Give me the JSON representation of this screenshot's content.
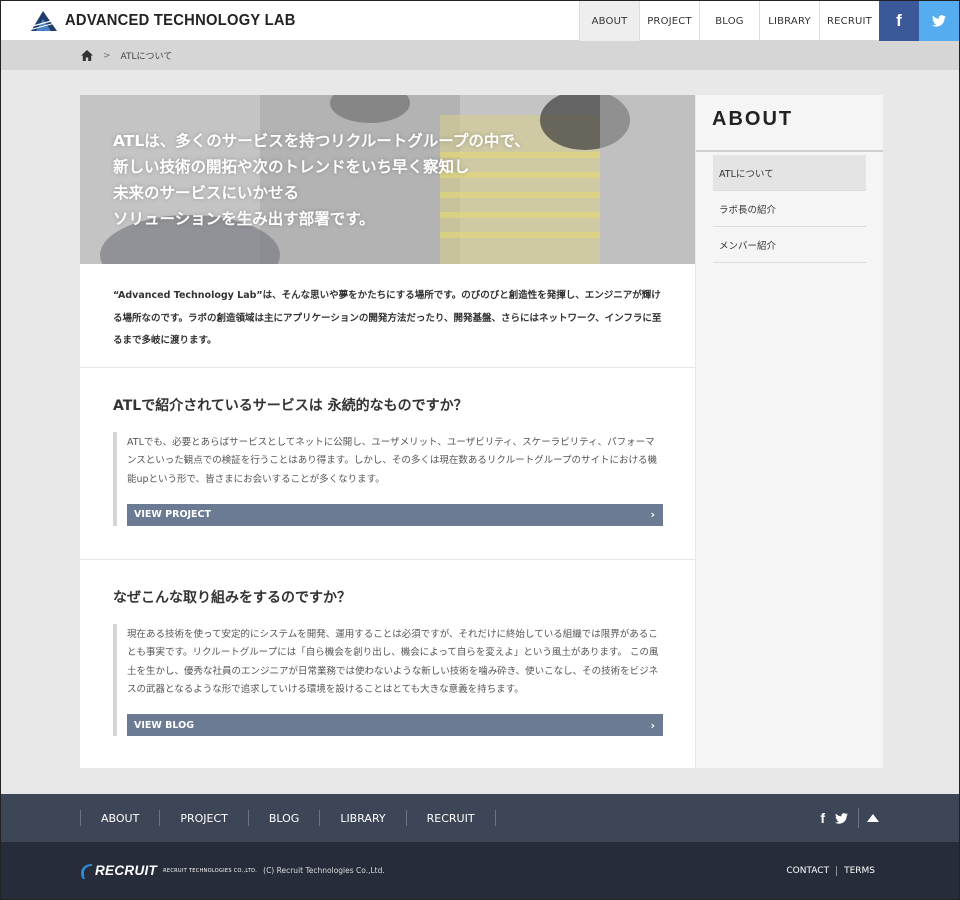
{
  "header": {
    "site_name": "ADVANCED TECHNOLOGY LAB",
    "nav": [
      "ABOUT",
      "PROJECT",
      "BLOG",
      "LIBRARY",
      "RECRUIT"
    ],
    "active_nav": "ABOUT",
    "facebook": "f",
    "colors": {
      "facebook": "#3b5998",
      "twitter": "#55acee"
    }
  },
  "breadcrumb": {
    "sep": ">",
    "current": "ATLについて"
  },
  "hero": {
    "lines": [
      "ATLは、多くのサービスを持つリクルートグループの中で、",
      "新しい技術の開拓や次のトレンドをいち早く察知し",
      "未来のサービスにいかせる",
      "ソリューションを生み出す部署です。"
    ]
  },
  "intro": "“Advanced Technology Lab”は、そんな思いや夢をかたちにする場所です。のびのびと創造性を発揮し、エンジニアが輝ける場所なのです。ラボの創造領域は主にアプリケーションの開発方法だったり、開発基盤、さらにはネットワーク、インフラに至るまで多岐に渡ります。",
  "sections": [
    {
      "title": "ATLで紹介されているサービスは 永続的なものですか？",
      "text": "ATLでも、必要とあらばサービスとしてネットに公開し、ユーザメリット、ユーザビリティ、スケーラビリティ、パフォーマンスといった観点での検証を行うことはあり得ます。しかし、その多くは現在数あるリクルートグループのサイトにおける機能upという形で、皆さまにお会いすることが多くなります。",
      "button": "VIEW PROJECT"
    },
    {
      "title": "なぜこんな取り組みをするのですか？",
      "text": "現在ある技術を使って安定的にシステムを開発、運用することは必須ですが、それだけに終始している組織では限界があることも事実です。リクルートグループには「自ら機会を創り出し、機会によって自らを変えよ」という風土があります。 この風土を生かし、優秀な社員のエンジニアが日常業務では使わないような新しい技術を噛み砕き、使いこなし、その技術をビジネスの武器となるような形で追求していける環境を設けることはとても大きな意義を持ちます。",
      "button": "VIEW BLOG"
    }
  ],
  "sidebar": {
    "title": "ABOUT",
    "items": [
      "ATLについて",
      "ラボ長の紹介",
      "メンバー紹介"
    ],
    "active": "ATLについて"
  },
  "footer_nav": {
    "items": [
      "ABOUT",
      "PROJECT",
      "BLOG",
      "LIBRARY",
      "RECRUIT"
    ],
    "facebook": "f"
  },
  "footer": {
    "brand": "RECRUIT",
    "brand_sub": "RECRUIT TECHNOLOGIES CO.,LTD.",
    "copyright": "(C) Recruit Technologies Co.,Ltd.",
    "links": [
      "CONTACT",
      "TERMS"
    ]
  }
}
